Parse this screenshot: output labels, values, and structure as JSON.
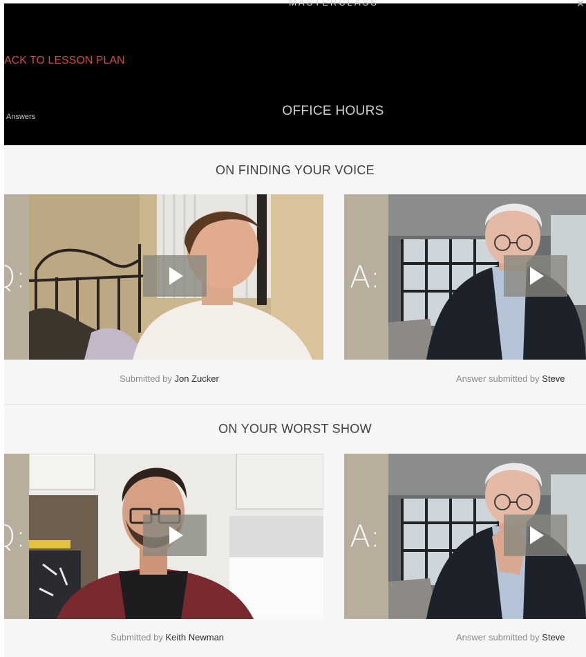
{
  "header": {
    "brand": "MASTERCLASS",
    "back_link": "ACK TO LESSON PLAN",
    "answers_link": "Answers",
    "title": "OFFICE HOURS"
  },
  "sections": [
    {
      "title": "ON FINDING YOUR VOICE",
      "question": {
        "letter": "Q:",
        "caption_prefix": "Submitted by",
        "submitter": "Jon Zucker"
      },
      "answer": {
        "letter": "A:",
        "caption_prefix": "Answer submitted by",
        "submitter": "Steve"
      }
    },
    {
      "title": "ON YOUR WORST SHOW",
      "question": {
        "letter": "Q:",
        "caption_prefix": "Submitted by",
        "submitter": "Keith Newman"
      },
      "answer": {
        "letter": "A:",
        "caption_prefix": "Answer submitted by",
        "submitter": "Steve"
      }
    }
  ],
  "colors": {
    "accent_red": "#c94a4e",
    "header_bg": "#000000",
    "card_tan": "#beb4a4"
  },
  "icons": {
    "play": "play-icon",
    "close": "close-icon"
  }
}
